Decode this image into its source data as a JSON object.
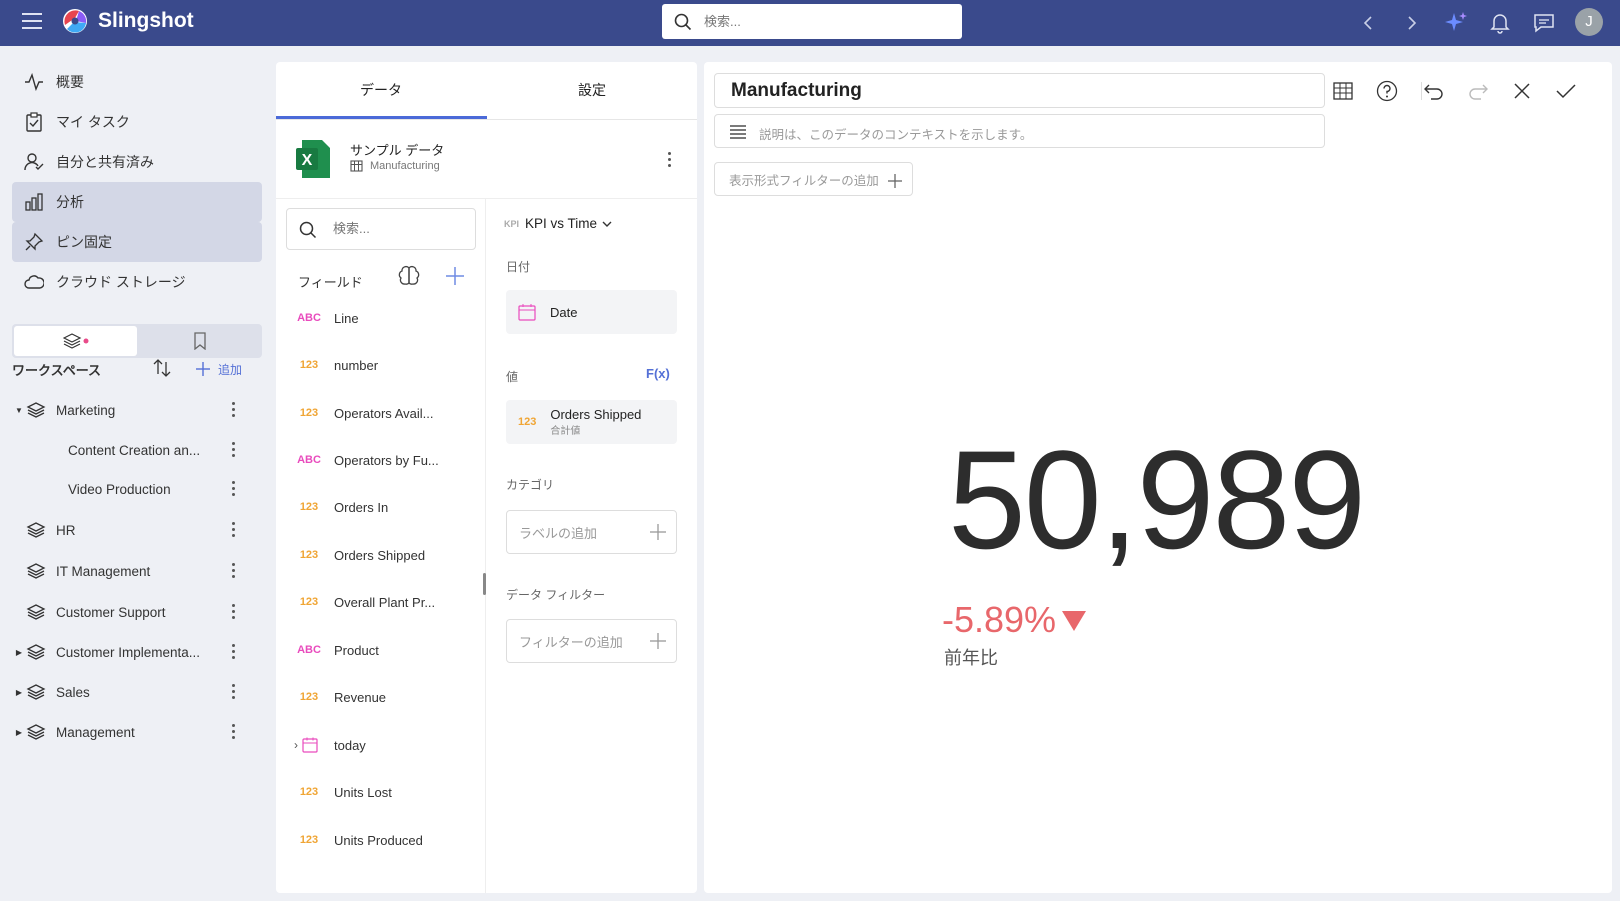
{
  "topbar": {
    "brand": "Slingshot",
    "search_placeholder": "検索...",
    "avatar_initial": "J",
    "icons": [
      "back-icon",
      "forward-icon",
      "sparkle-icon",
      "bell-icon",
      "chat-icon"
    ]
  },
  "sidebar": {
    "nav": [
      {
        "label": "概要",
        "icon": "pulse-icon"
      },
      {
        "label": "マイ タスク",
        "icon": "clipboard-check-icon"
      },
      {
        "label": "自分と共有済み",
        "icon": "user-check-icon"
      },
      {
        "label": "分析",
        "icon": "bar-chart-icon",
        "active": true
      },
      {
        "label": "ピン固定",
        "icon": "pin-icon",
        "active": true
      },
      {
        "label": "クラウド ストレージ",
        "icon": "cloud-icon"
      }
    ],
    "workspace_title": "ワークスペース",
    "add_label": "追加",
    "workspaces": [
      {
        "label": "Marketing",
        "expanded": true
      },
      {
        "label": "Content Creation an...",
        "child": true
      },
      {
        "label": "Video Production",
        "child": true
      },
      {
        "label": "HR"
      },
      {
        "label": "IT Management"
      },
      {
        "label": "Customer Support"
      },
      {
        "label": "Customer Implementa...",
        "collapsed": true
      },
      {
        "label": "Sales",
        "collapsed": true
      },
      {
        "label": "Management",
        "collapsed": true
      }
    ]
  },
  "data_panel": {
    "tabs": [
      "データ",
      "設定"
    ],
    "datasource_name": "サンプル データ",
    "datasource_sheet": "Manufacturing",
    "search_placeholder": "検索...",
    "fields_label": "フィールド",
    "fields": [
      {
        "type": "ABC",
        "name": "Line"
      },
      {
        "type": "123",
        "name": "number"
      },
      {
        "type": "123",
        "name": "Operators Avail..."
      },
      {
        "type": "ABC",
        "name": "Operators by Fu..."
      },
      {
        "type": "123",
        "name": "Orders In"
      },
      {
        "type": "123",
        "name": "Orders Shipped"
      },
      {
        "type": "123",
        "name": "Overall Plant Pr..."
      },
      {
        "type": "ABC",
        "name": "Product"
      },
      {
        "type": "123",
        "name": "Revenue"
      },
      {
        "type": "date",
        "name": "today"
      },
      {
        "type": "123",
        "name": "Units Lost"
      },
      {
        "type": "123",
        "name": "Units Produced"
      }
    ],
    "viz_type_badge": "KPI",
    "viz_type": "KPI vs Time",
    "date_section": "日付",
    "date_field": "Date",
    "value_section": "値",
    "fx_label": "F(x)",
    "value_field_type": "123",
    "value_field": "Orders Shipped",
    "value_agg": "合計値",
    "category_section": "カテゴリ",
    "category_placeholder": "ラベルの追加",
    "filter_section": "データ フィルター",
    "filter_placeholder": "フィルターの追加"
  },
  "viz": {
    "title": "Manufacturing",
    "description_placeholder": "説明は、このデータのコンテキストを示します。",
    "display_filter": "表示形式フィルターの追加",
    "kpi_value": "50,989",
    "kpi_delta": "-5.89%",
    "kpi_caption": "前年比",
    "colors": {
      "negative": "#e8676b",
      "accent": "#4b6ad8",
      "topbar": "#3a4a8c"
    }
  }
}
